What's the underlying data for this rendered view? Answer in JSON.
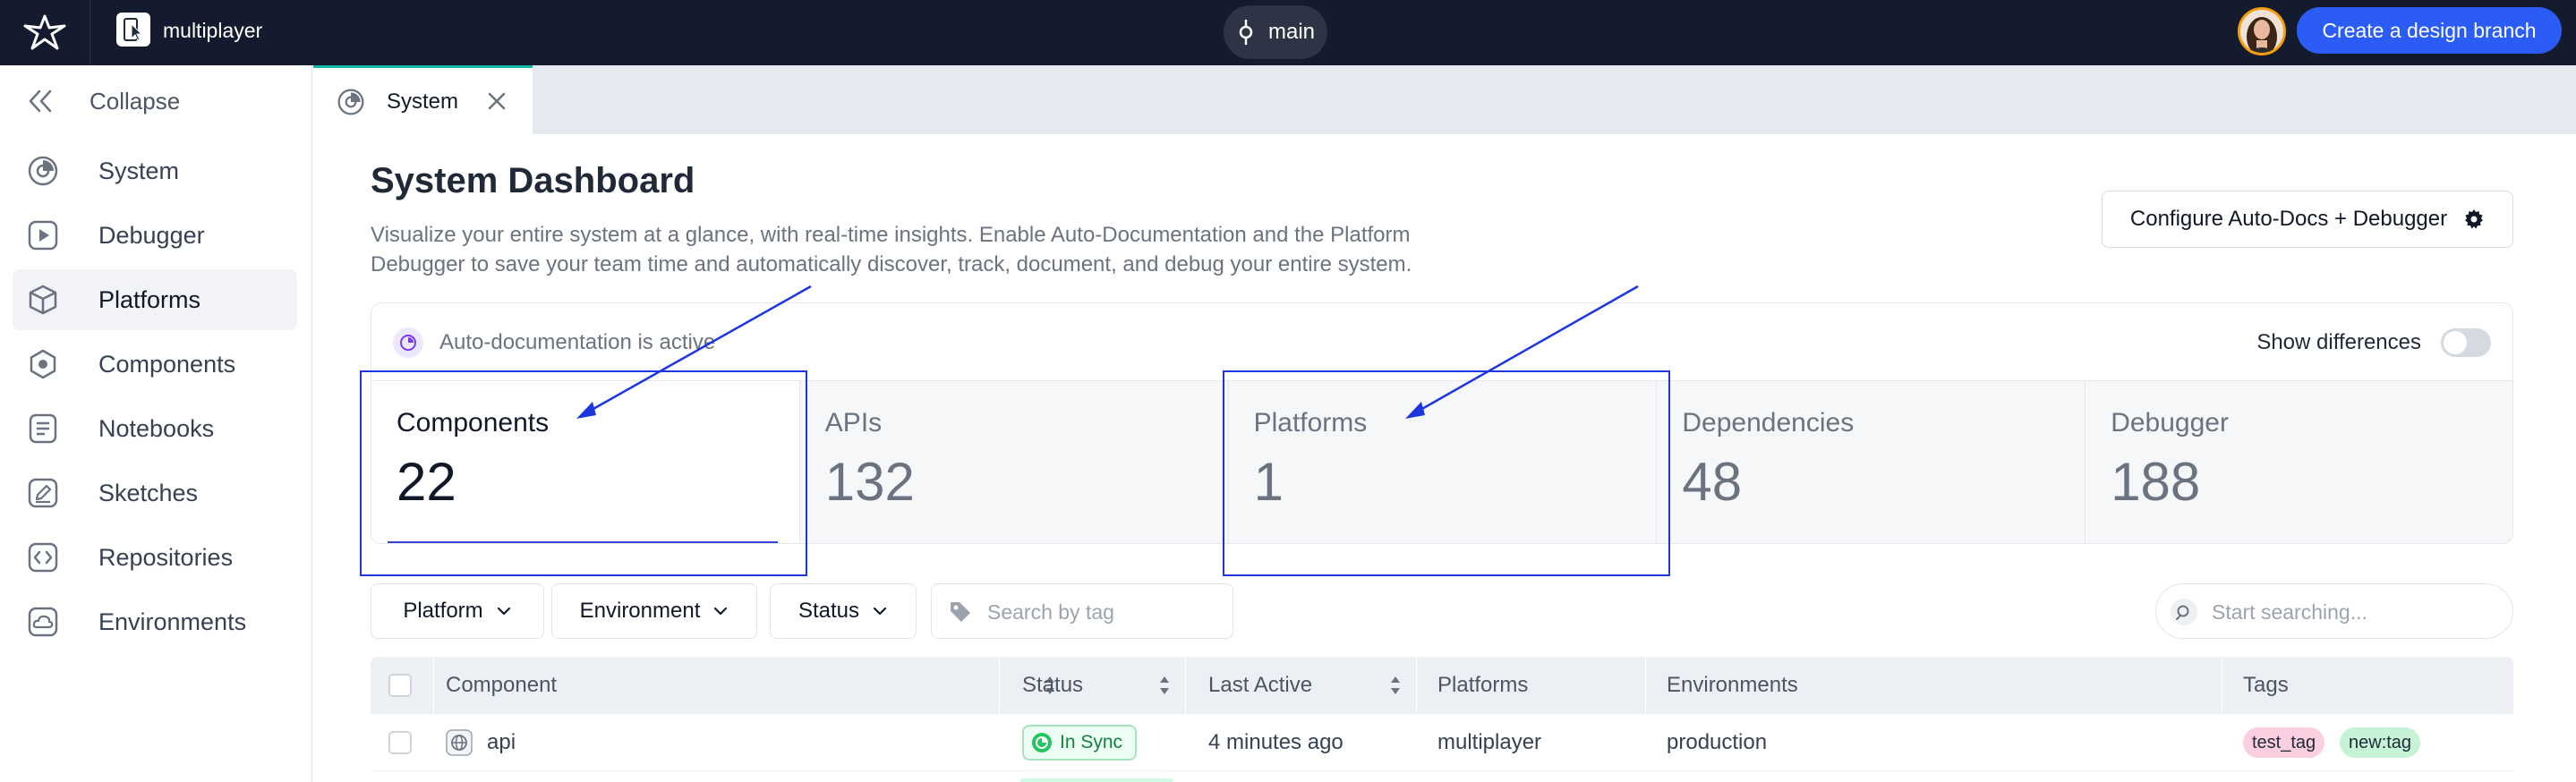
{
  "topbar": {
    "workspace_name": "multiplayer",
    "branch": "main",
    "create_branch_label": "Create a design branch"
  },
  "sidebar": {
    "collapse_label": "Collapse",
    "items": [
      {
        "label": "System",
        "icon": "system-icon"
      },
      {
        "label": "Debugger",
        "icon": "play-icon"
      },
      {
        "label": "Platforms",
        "icon": "cube-icon",
        "active": true
      },
      {
        "label": "Components",
        "icon": "hexagon-icon"
      },
      {
        "label": "Notebooks",
        "icon": "notebook-icon"
      },
      {
        "label": "Sketches",
        "icon": "pencil-icon"
      },
      {
        "label": "Repositories",
        "icon": "code-icon"
      },
      {
        "label": "Environments",
        "icon": "cloud-icon"
      }
    ]
  },
  "tabs": [
    {
      "label": "System",
      "icon": "system-icon"
    }
  ],
  "main": {
    "title": "System Dashboard",
    "description": "Visualize your entire system at a glance, with real-time insights. Enable Auto-Documentation and the Platform Debugger to save your team time and automatically discover, track, document, and debug your entire system.",
    "config_button_label": "Configure Auto-Docs + Debugger",
    "autodoc_status": "Auto-documentation is active",
    "show_differences_label": "Show differences",
    "stats": [
      {
        "label": "Components",
        "value": "22"
      },
      {
        "label": "APIs",
        "value": "132"
      },
      {
        "label": "Platforms",
        "value": "1"
      },
      {
        "label": "Dependencies",
        "value": "48"
      },
      {
        "label": "Debugger",
        "value": "188"
      }
    ]
  },
  "filters": {
    "platform_label": "Platform",
    "environment_label": "Environment",
    "status_label": "Status",
    "tag_search_placeholder": "Search by tag",
    "search_placeholder": "Start searching..."
  },
  "table": {
    "columns": [
      "Component",
      "Status",
      "Last Active",
      "Platforms",
      "Environments",
      "Tags"
    ],
    "rows": [
      {
        "component": "api",
        "status": "In Sync",
        "last_active": "4 minutes ago",
        "platforms": "multiplayer",
        "environments": "production",
        "tags": [
          "test_tag",
          "new:tag"
        ]
      }
    ]
  },
  "colors": {
    "topbar_bg": "#141b2e",
    "primary": "#2b5cf6",
    "tab_accent": "#14b8a6",
    "annotation": "#1d36e0",
    "sync_green": "#15803d",
    "tag_pink": "#fbcfe0",
    "tag_green": "#c6f2d6"
  }
}
